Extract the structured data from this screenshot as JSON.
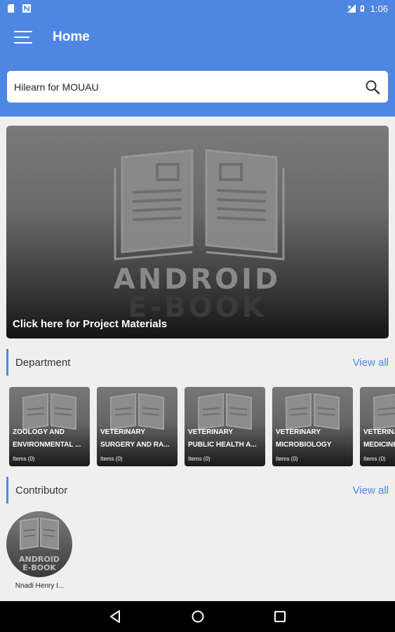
{
  "status_bar": {
    "time": "1:06"
  },
  "app_bar": {
    "title": "Home"
  },
  "search": {
    "value": "Hilearn for MOUAU"
  },
  "banner": {
    "caption": "Click here for Project Materials",
    "art_text_1": "ANDROID",
    "art_text_2": "E-BOOK"
  },
  "department": {
    "heading": "Department",
    "view_all": "View all",
    "cards": [
      {
        "line1": "ZOOLOGY AND",
        "line2": "ENVIRONMENTAL ...",
        "items": "Items (0)"
      },
      {
        "line1": "VETERINARY",
        "line2": "SURGERY AND RA...",
        "items": "Items (0)"
      },
      {
        "line1": "VETERINARY",
        "line2": "PUBLIC HEALTH A...",
        "items": "Items (0)"
      },
      {
        "line1": "VETERINARY",
        "line2": "MICROBIOLOGY",
        "items": "Items (0)"
      },
      {
        "line1": "VETERINARY",
        "line2": "MEDICINE",
        "items": "Items (0)"
      }
    ]
  },
  "contributor": {
    "heading": "Contributor",
    "view_all": "View all",
    "people": [
      {
        "name": "Nnadi Henry I..."
      }
    ]
  },
  "colors": {
    "primary": "#4e86e4",
    "background": "#efefef",
    "nav_bar": "#000000"
  }
}
